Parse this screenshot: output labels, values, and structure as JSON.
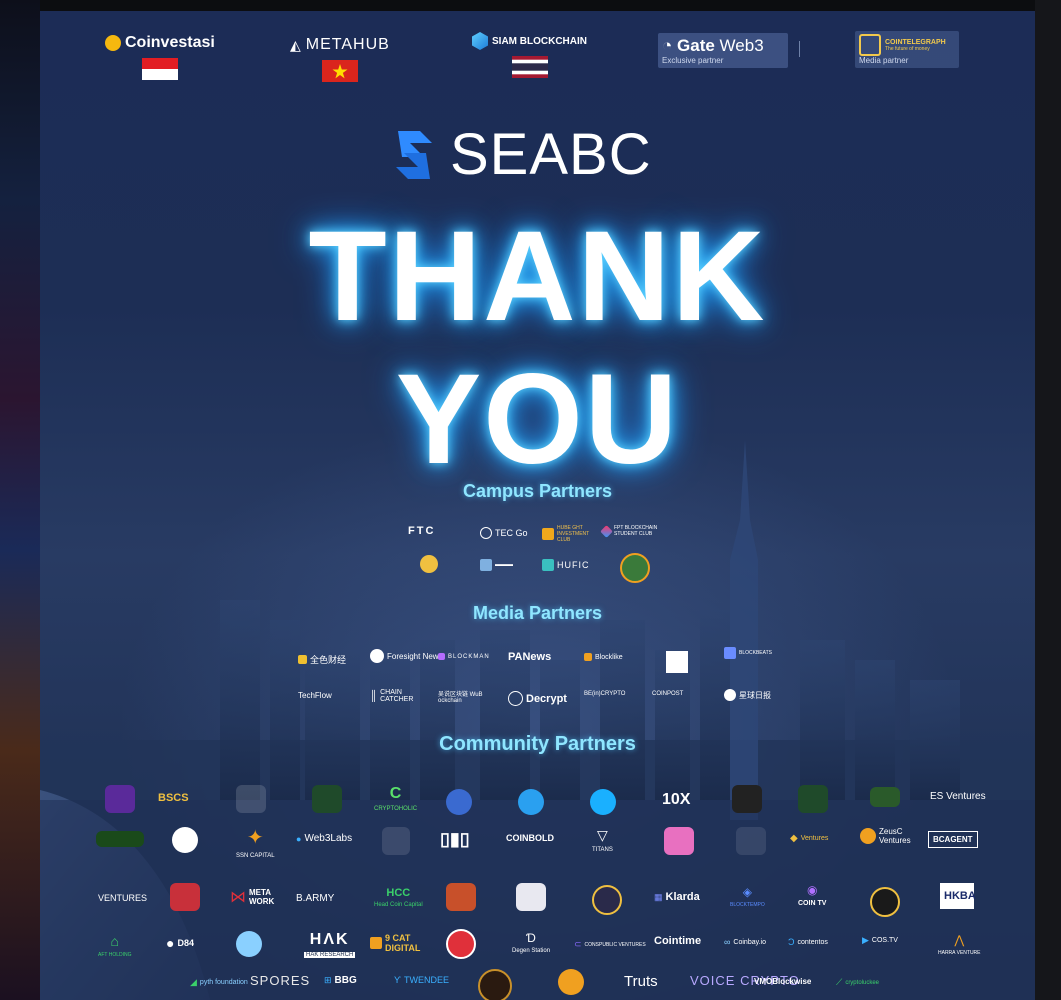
{
  "top_partners": {
    "coinvestasi": "Coinvestasi",
    "metahub": "METAHUB",
    "siam": "SIAM BLOCKCHAIN",
    "gate_title": "Gate",
    "gate_suffix": "Web3",
    "gate_sub": "Exclusive partner",
    "ct_title": "COINTELEGRAPH",
    "ct_tagline": "The future of money",
    "ct_sub": "Media partner"
  },
  "brand": "SEABC",
  "headline": [
    "THANK",
    "YOU"
  ],
  "sections": {
    "campus": "Campus Partners",
    "media": "Media Partners",
    "community": "Community Partners"
  },
  "campus_logos": [
    "FTC",
    "TEC Go",
    "HUBE GHT INVESTMENT CLUB",
    "FPT BLOCKCHAIN STUDENT CLUB",
    "HUFIC"
  ],
  "media_logos": [
    "全色财经",
    "Foresight News",
    "BLOCKMAN",
    "PANews",
    "Blocklike",
    "BLOCKBEATS",
    "TechFlow",
    "CHAIN CATCHER",
    "吴说区块链 WuB ockchain",
    "Decrypt",
    "BE(in)CRYPTO",
    "COINPOST",
    "星球日报"
  ],
  "community_logos": {
    "r1": [
      "BSCS",
      "CRYPTOHOLIC",
      "10X",
      "ES Ventures"
    ],
    "r2": [
      "Web3Labs",
      "COINBOLD",
      "TITANS",
      "Ventures",
      "ZeusC Ventures",
      "BCAGENT",
      "SSN CAPITAL"
    ],
    "r3": [
      "VENTURES",
      "META WORK",
      "B.ARMY",
      "HCC",
      "Head Coin Capital",
      "Klarda",
      "BLOCKTEMPO",
      "COIN TV",
      "HKBA"
    ],
    "r4": [
      "AFT HOLDING",
      "D84",
      "HAK RESEARCH",
      "9 CAT DIGITAL",
      "Degen Station",
      "CONSPUBLIC VENTURES",
      "Cointime",
      "Coinbay.io",
      "contentos",
      "COS.TV",
      "HARRA VENTURE"
    ],
    "r5": [
      "pyth foundation",
      "SPORES",
      "BBG",
      "TWENDEE",
      "Truts",
      "VOICE CRYPTO",
      "VMOBlockwise",
      "cryptoluckee"
    ]
  },
  "colors": {
    "headline_glow": "#2ab4ff",
    "section_title": "#8fe6ff",
    "brand_blue": "#1f7cff"
  }
}
